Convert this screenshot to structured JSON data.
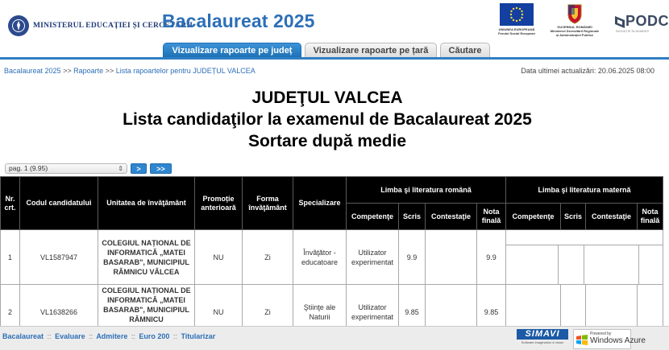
{
  "header": {
    "ministry_name": "MINISTERUL EDUCAȚIEI ȘI CERCETĂRII",
    "app_title": "Bacalaureat 2025",
    "eu_caption": "UNIUNEA EUROPEANĂ Fondul Social European",
    "gov_caption": "GUVERNUL ROMÂNIEI Ministerul Dezvoltării Regionale și Administrației Publice",
    "pod_label": "PODCA",
    "pod_sub": "INOVAȚIE ÎN ADMINIS"
  },
  "tabs": [
    {
      "label": "Vizualizare rapoarte pe județ",
      "active": true
    },
    {
      "label": "Vizualizare rapoarte pe țară",
      "active": false
    },
    {
      "label": "Căutare",
      "active": false
    }
  ],
  "breadcrumb": {
    "items": [
      "Bacalaureat 2025",
      "Rapoarte",
      "Lista rapoartelor pentru JUDEȚUL VALCEA"
    ],
    "separator": ">>"
  },
  "last_update": "Data ultimei actualizări: 20.06.2025 08:00",
  "heading": {
    "line1": "JUDEŢUL VALCEA",
    "line2": "Lista candidaţilor la examenul de Bacalaureat 2025",
    "line3": "Sortare după medie"
  },
  "pager": {
    "selected_page": "pag. 1 (9.95)",
    "next_label": ">",
    "last_label": ">>"
  },
  "table": {
    "headers": {
      "nr": "Nr. crt.",
      "code": "Codul candidatului",
      "school": "Unitatea de învăţământ",
      "promo": "Promoție anterioară",
      "form": "Forma învăţământ",
      "spec": "Specializare",
      "group_ro": "Limba şi literatura română",
      "group_matern": "Limba şi literatura maternă",
      "sub_comp": "Competenţe",
      "sub_scris": "Scris",
      "sub_contest": "Contestaţie",
      "sub_nota": "Nota finală"
    },
    "rows": [
      {
        "nr": "1",
        "code": "VL1587947",
        "school": "COLEGIUL NAȚIONAL DE INFORMATICĂ „MATEI BASARAB\", MUNICIPIUL RÂMNICU VÂLCEA",
        "promo": "NU",
        "form": "Zi",
        "spec": "Învăţător - educatoare",
        "ro_comp": "Utilizator experimentat",
        "ro_scris": "9.9",
        "ro_contest": "",
        "ro_nota": "9.9"
      },
      {
        "nr": "2",
        "code": "VL1638266",
        "school": "COLEGIUL NAȚIONAL DE INFORMATICĂ „MATEI BASARAB\", MUNICIPIUL RÂMNICU",
        "promo": "NU",
        "form": "Zi",
        "spec": "Ştiinţe ale Naturii",
        "ro_comp": "Utilizator experimentat",
        "ro_scris": "9.85",
        "ro_contest": "",
        "ro_nota": "9.85"
      }
    ]
  },
  "footer": {
    "links": [
      "Bacalaureat",
      "Evaluare",
      "Admitere",
      "Euro 200",
      "Titularizar"
    ],
    "separator": "::",
    "simavi_label": "SIMAVI",
    "simavi_sub": "Software imagination & vision",
    "azure_powered": "Powered by",
    "azure_name": "Windows Azure"
  },
  "colors": {
    "brand_blue": "#2d6fb7",
    "tab_active": "#1c6fb5",
    "table_header": "#000000",
    "link_school": "#1f5fa8"
  }
}
